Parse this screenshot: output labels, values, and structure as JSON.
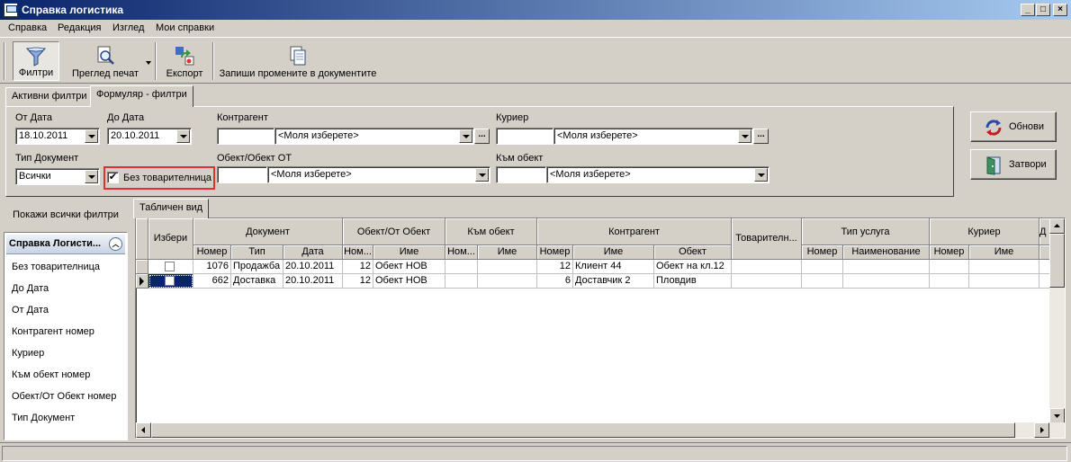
{
  "window": {
    "title": "Справка логистика"
  },
  "menu": [
    "Справка",
    "Редакция",
    "Изглед",
    "Мои справки"
  ],
  "toolbar": {
    "filters": "Филтри",
    "print_preview": "Преглед печат",
    "export": "Експорт",
    "save_changes": "Запиши промените в документите"
  },
  "tabs": [
    "Активни филтри",
    "Формуляр - филтри"
  ],
  "filters": {
    "from_date_label": "От Дата",
    "from_date_value": "18.10.2011",
    "to_date_label": "До Дата",
    "to_date_value": "20.10.2011",
    "contractor_label": "Контрагент",
    "contractor_select": "<Моля изберете>",
    "courier_label": "Куриер",
    "courier_select": "<Моля изберете>",
    "doc_type_label": "Тип Документ",
    "doc_type_value": "Всички",
    "no_waybill_label": "Без товарителница",
    "no_waybill_checked": "✔",
    "object_from_label": "Обект/Обект ОТ",
    "object_from_select": "<Моля изберете>",
    "to_object_label": "Към обект",
    "to_object_select": "<Моля изберете>"
  },
  "side_buttons": {
    "refresh": "Обнови",
    "close": "Затвори"
  },
  "left_panel": {
    "show_all": "Покажи всички филтри",
    "header": "Справка Логисти...",
    "items": [
      "Без товарителница",
      "До Дата",
      "От Дата",
      "Контрагент номер",
      "Куриер",
      "Към обект номер",
      "Обект/От Обект номер",
      "Тип Документ"
    ]
  },
  "grid_tab": "Табличен вид",
  "grid": {
    "groups": {
      "select": "Избери",
      "document": "Документ",
      "object_from": "Обект/От Обект",
      "to_object": "Към обект",
      "contractor": "Контрагент",
      "waybill": "Товарителн...",
      "service_type": "Тип услуга",
      "courier": "Куриер",
      "extra": "Д"
    },
    "columns": {
      "doc_no": "Номер",
      "doc_type": "Тип",
      "doc_date": "Дата",
      "obj_no": "Ном...",
      "obj_name": "Име",
      "to_no": "Ном...",
      "to_name": "Име",
      "c_no": "Номер",
      "c_name": "Име",
      "c_object": "Обект",
      "st_no": "Номер",
      "st_name": "Наименование",
      "cr_no": "Номер",
      "cr_name": "Име"
    },
    "rows": [
      {
        "doc_no": "1076",
        "doc_type": "Продажба",
        "doc_date": "20.10.2011",
        "obj_no": "12",
        "obj_name": "Обект НОВ",
        "c_no": "12",
        "c_name": "Клиент 44",
        "c_object": "Обект на кл.12"
      },
      {
        "doc_no": "662",
        "doc_type": "Доставка",
        "doc_date": "20.10.2011",
        "obj_no": "12",
        "obj_name": "Обект НОВ",
        "c_no": "6",
        "c_name": "Доставчик 2",
        "c_object": "Пловдив"
      }
    ]
  }
}
